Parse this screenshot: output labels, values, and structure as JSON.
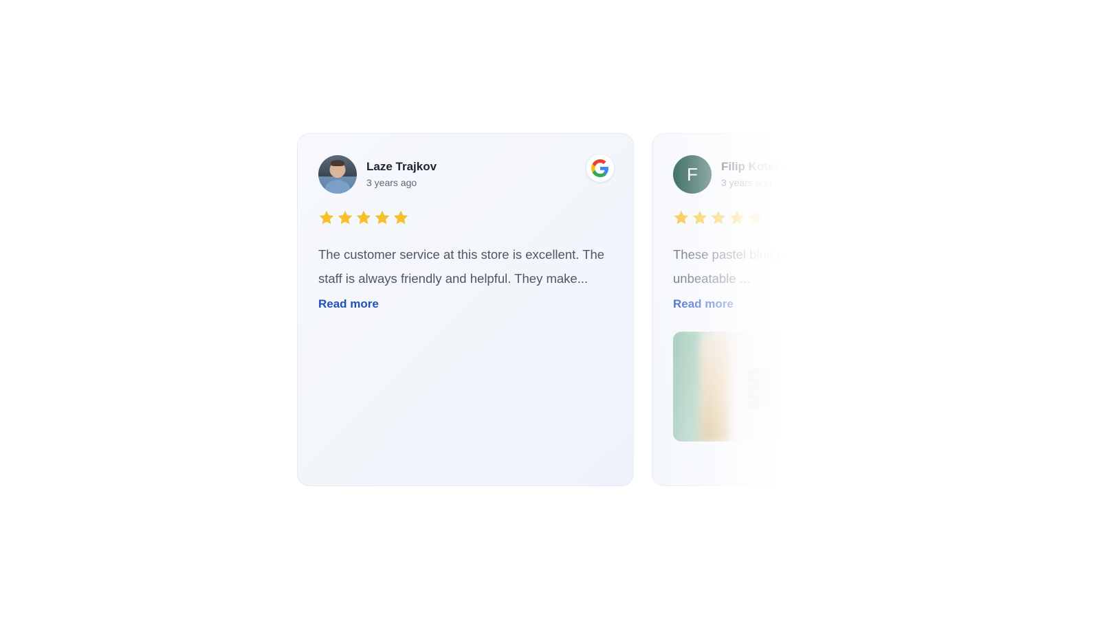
{
  "reviews": [
    {
      "author_name": "Laze Trajkov",
      "time_ago": "3 years ago",
      "avatar_type": "photo",
      "rating": 5,
      "text": "The customer service at this store is excellent. The staff is always friendly and helpful. They make...",
      "read_more_label": "Read more",
      "has_photo": false,
      "source_icon": "google-icon"
    },
    {
      "author_name": "Filip Koteski",
      "time_ago": "3 years ago",
      "avatar_type": "letter",
      "avatar_letter": "F",
      "rating": 5,
      "text": "These pastel blue pants eye-catching color with unbeatable ...",
      "read_more_label": "Read more",
      "has_photo": true
    }
  ],
  "colors": {
    "star": "#f5c02a",
    "read_more": "#1f4fbf",
    "letter_avatar_bg": "#0f4c3e",
    "card_border": "#e6ebf3"
  }
}
